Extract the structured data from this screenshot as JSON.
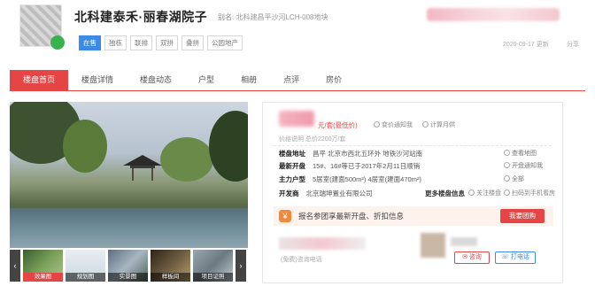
{
  "header": {
    "title": "北科建泰禾·丽春湖院子",
    "alias_label": "别名:",
    "alias": "北科建昌平沙河LCH-008地块",
    "updated": "2020-09-17 更新",
    "share": "分享"
  },
  "tags": [
    "在售",
    "独栋",
    "联排",
    "双拼",
    "叠拼",
    "公园地产"
  ],
  "nav": [
    "楼盘首页",
    "楼盘详情",
    "楼盘动态",
    "户型",
    "相册",
    "点评",
    "房价"
  ],
  "gallery": {
    "thumbs": [
      "效果图",
      "规划图",
      "实景图",
      "样板间",
      "项目证照"
    ]
  },
  "info": {
    "price_unit": "元/套(最低价)",
    "subscribe": "变价通知我",
    "calculator": "计算月供",
    "total": "价格说明  总价2200万/套",
    "rows": [
      {
        "k": "楼盘地址",
        "v": "昌平  北京市西北五环外 地铁沙河站南"
      },
      {
        "k": "最新开盘",
        "v": "15#、16#等已于2017年2月11日顺销"
      },
      {
        "k": "主力户型",
        "v": "5居室(建面500m²)  4居室(建面470m²)"
      },
      {
        "k": "开发商",
        "v": "北京瑞坤置业有限公司"
      }
    ],
    "side": [
      "查看地图",
      "开盘通知我",
      "全部"
    ],
    "more": "更多楼盘信息",
    "follow": "关注楼盘",
    "phone_view": "扫码到手机看房",
    "banner_text": "报名参团享最新开盘、折扣信息",
    "banner_btn": "我要团购",
    "agent_sub": "(免费)咨询电话",
    "ask": "咨询",
    "call": "打电话"
  },
  "colors": {
    "accent": "#e64545",
    "blue": "#3b8be6"
  }
}
